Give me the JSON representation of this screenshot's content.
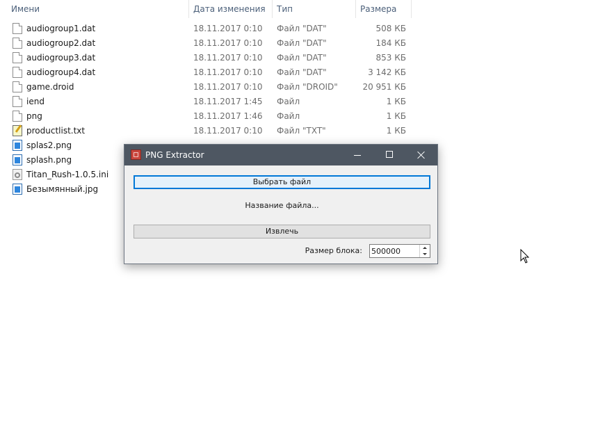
{
  "explorer": {
    "columns": {
      "name": "Имени",
      "date": "Дата изменения",
      "type": "Тип",
      "size": "Размера"
    },
    "files": [
      {
        "name": "audiogroup1.dat",
        "date": "18.11.2017 0:10",
        "type": "Файл \"DAT\"",
        "size": "508 КБ",
        "icon": "file-icon"
      },
      {
        "name": "audiogroup2.dat",
        "date": "18.11.2017 0:10",
        "type": "Файл \"DAT\"",
        "size": "184 КБ",
        "icon": "file-icon"
      },
      {
        "name": "audiogroup3.dat",
        "date": "18.11.2017 0:10",
        "type": "Файл \"DAT\"",
        "size": "853 КБ",
        "icon": "file-icon"
      },
      {
        "name": "audiogroup4.dat",
        "date": "18.11.2017 0:10",
        "type": "Файл \"DAT\"",
        "size": "3 142 КБ",
        "icon": "file-icon"
      },
      {
        "name": "game.droid",
        "date": "18.11.2017 0:10",
        "type": "Файл \"DROID\"",
        "size": "20 951 КБ",
        "icon": "file-icon"
      },
      {
        "name": "iend",
        "date": "18.11.2017 1:45",
        "type": "Файл",
        "size": "1 КБ",
        "icon": "file-icon"
      },
      {
        "name": "png",
        "date": "18.11.2017 1:46",
        "type": "Файл",
        "size": "1 КБ",
        "icon": "file-icon"
      },
      {
        "name": "productlist.txt",
        "date": "18.11.2017 0:10",
        "type": "Файл \"TXT\"",
        "size": "1 КБ",
        "icon": "text-file-icon"
      },
      {
        "name": "splas2.png",
        "date": "",
        "type": "",
        "size": "",
        "icon": "image-file-icon"
      },
      {
        "name": "splash.png",
        "date": "",
        "type": "",
        "size": "",
        "icon": "image-file-icon"
      },
      {
        "name": "Titan_Rush-1.0.5.ini",
        "date": "",
        "type": "",
        "size": "",
        "icon": "settings-file-icon"
      },
      {
        "name": "Безымянный.jpg",
        "date": "",
        "type": "",
        "size": "",
        "icon": "image-file-icon"
      }
    ]
  },
  "dialog": {
    "title": "PNG Extractor",
    "select_button": "Выбрать файл",
    "filename_label": "Название файла...",
    "extract_button": "Извлечь",
    "block_size_label": "Размер блока:",
    "block_size_value": "500000"
  },
  "colors": {
    "titlebar": "#4e5762",
    "focus_border": "#0078d7",
    "header_text": "#4c607a"
  }
}
